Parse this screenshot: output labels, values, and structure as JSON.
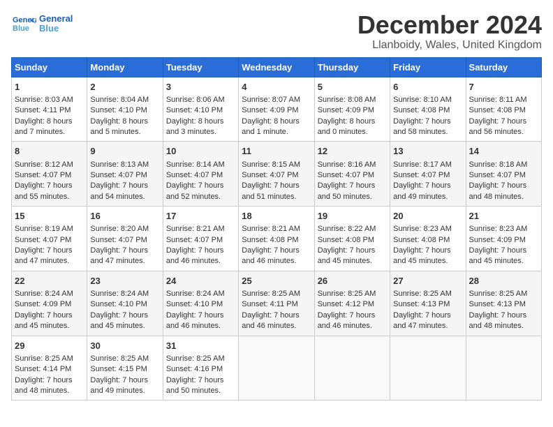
{
  "header": {
    "logo_line1": "General",
    "logo_line2": "Blue",
    "month_title": "December 2024",
    "location": "Llanboidy, Wales, United Kingdom"
  },
  "weekdays": [
    "Sunday",
    "Monday",
    "Tuesday",
    "Wednesday",
    "Thursday",
    "Friday",
    "Saturday"
  ],
  "weeks": [
    [
      {
        "day": "1",
        "lines": [
          "Sunrise: 8:03 AM",
          "Sunset: 4:11 PM",
          "Daylight: 8 hours",
          "and 7 minutes."
        ]
      },
      {
        "day": "2",
        "lines": [
          "Sunrise: 8:04 AM",
          "Sunset: 4:10 PM",
          "Daylight: 8 hours",
          "and 5 minutes."
        ]
      },
      {
        "day": "3",
        "lines": [
          "Sunrise: 8:06 AM",
          "Sunset: 4:10 PM",
          "Daylight: 8 hours",
          "and 3 minutes."
        ]
      },
      {
        "day": "4",
        "lines": [
          "Sunrise: 8:07 AM",
          "Sunset: 4:09 PM",
          "Daylight: 8 hours",
          "and 1 minute."
        ]
      },
      {
        "day": "5",
        "lines": [
          "Sunrise: 8:08 AM",
          "Sunset: 4:09 PM",
          "Daylight: 8 hours",
          "and 0 minutes."
        ]
      },
      {
        "day": "6",
        "lines": [
          "Sunrise: 8:10 AM",
          "Sunset: 4:08 PM",
          "Daylight: 7 hours",
          "and 58 minutes."
        ]
      },
      {
        "day": "7",
        "lines": [
          "Sunrise: 8:11 AM",
          "Sunset: 4:08 PM",
          "Daylight: 7 hours",
          "and 56 minutes."
        ]
      }
    ],
    [
      {
        "day": "8",
        "lines": [
          "Sunrise: 8:12 AM",
          "Sunset: 4:07 PM",
          "Daylight: 7 hours",
          "and 55 minutes."
        ]
      },
      {
        "day": "9",
        "lines": [
          "Sunrise: 8:13 AM",
          "Sunset: 4:07 PM",
          "Daylight: 7 hours",
          "and 54 minutes."
        ]
      },
      {
        "day": "10",
        "lines": [
          "Sunrise: 8:14 AM",
          "Sunset: 4:07 PM",
          "Daylight: 7 hours",
          "and 52 minutes."
        ]
      },
      {
        "day": "11",
        "lines": [
          "Sunrise: 8:15 AM",
          "Sunset: 4:07 PM",
          "Daylight: 7 hours",
          "and 51 minutes."
        ]
      },
      {
        "day": "12",
        "lines": [
          "Sunrise: 8:16 AM",
          "Sunset: 4:07 PM",
          "Daylight: 7 hours",
          "and 50 minutes."
        ]
      },
      {
        "day": "13",
        "lines": [
          "Sunrise: 8:17 AM",
          "Sunset: 4:07 PM",
          "Daylight: 7 hours",
          "and 49 minutes."
        ]
      },
      {
        "day": "14",
        "lines": [
          "Sunrise: 8:18 AM",
          "Sunset: 4:07 PM",
          "Daylight: 7 hours",
          "and 48 minutes."
        ]
      }
    ],
    [
      {
        "day": "15",
        "lines": [
          "Sunrise: 8:19 AM",
          "Sunset: 4:07 PM",
          "Daylight: 7 hours",
          "and 47 minutes."
        ]
      },
      {
        "day": "16",
        "lines": [
          "Sunrise: 8:20 AM",
          "Sunset: 4:07 PM",
          "Daylight: 7 hours",
          "and 47 minutes."
        ]
      },
      {
        "day": "17",
        "lines": [
          "Sunrise: 8:21 AM",
          "Sunset: 4:07 PM",
          "Daylight: 7 hours",
          "and 46 minutes."
        ]
      },
      {
        "day": "18",
        "lines": [
          "Sunrise: 8:21 AM",
          "Sunset: 4:08 PM",
          "Daylight: 7 hours",
          "and 46 minutes."
        ]
      },
      {
        "day": "19",
        "lines": [
          "Sunrise: 8:22 AM",
          "Sunset: 4:08 PM",
          "Daylight: 7 hours",
          "and 45 minutes."
        ]
      },
      {
        "day": "20",
        "lines": [
          "Sunrise: 8:23 AM",
          "Sunset: 4:08 PM",
          "Daylight: 7 hours",
          "and 45 minutes."
        ]
      },
      {
        "day": "21",
        "lines": [
          "Sunrise: 8:23 AM",
          "Sunset: 4:09 PM",
          "Daylight: 7 hours",
          "and 45 minutes."
        ]
      }
    ],
    [
      {
        "day": "22",
        "lines": [
          "Sunrise: 8:24 AM",
          "Sunset: 4:09 PM",
          "Daylight: 7 hours",
          "and 45 minutes."
        ]
      },
      {
        "day": "23",
        "lines": [
          "Sunrise: 8:24 AM",
          "Sunset: 4:10 PM",
          "Daylight: 7 hours",
          "and 45 minutes."
        ]
      },
      {
        "day": "24",
        "lines": [
          "Sunrise: 8:24 AM",
          "Sunset: 4:10 PM",
          "Daylight: 7 hours",
          "and 46 minutes."
        ]
      },
      {
        "day": "25",
        "lines": [
          "Sunrise: 8:25 AM",
          "Sunset: 4:11 PM",
          "Daylight: 7 hours",
          "and 46 minutes."
        ]
      },
      {
        "day": "26",
        "lines": [
          "Sunrise: 8:25 AM",
          "Sunset: 4:12 PM",
          "Daylight: 7 hours",
          "and 46 minutes."
        ]
      },
      {
        "day": "27",
        "lines": [
          "Sunrise: 8:25 AM",
          "Sunset: 4:13 PM",
          "Daylight: 7 hours",
          "and 47 minutes."
        ]
      },
      {
        "day": "28",
        "lines": [
          "Sunrise: 8:25 AM",
          "Sunset: 4:13 PM",
          "Daylight: 7 hours",
          "and 48 minutes."
        ]
      }
    ],
    [
      {
        "day": "29",
        "lines": [
          "Sunrise: 8:25 AM",
          "Sunset: 4:14 PM",
          "Daylight: 7 hours",
          "and 48 minutes."
        ]
      },
      {
        "day": "30",
        "lines": [
          "Sunrise: 8:25 AM",
          "Sunset: 4:15 PM",
          "Daylight: 7 hours",
          "and 49 minutes."
        ]
      },
      {
        "day": "31",
        "lines": [
          "Sunrise: 8:25 AM",
          "Sunset: 4:16 PM",
          "Daylight: 7 hours",
          "and 50 minutes."
        ]
      },
      {
        "day": "",
        "lines": []
      },
      {
        "day": "",
        "lines": []
      },
      {
        "day": "",
        "lines": []
      },
      {
        "day": "",
        "lines": []
      }
    ]
  ]
}
